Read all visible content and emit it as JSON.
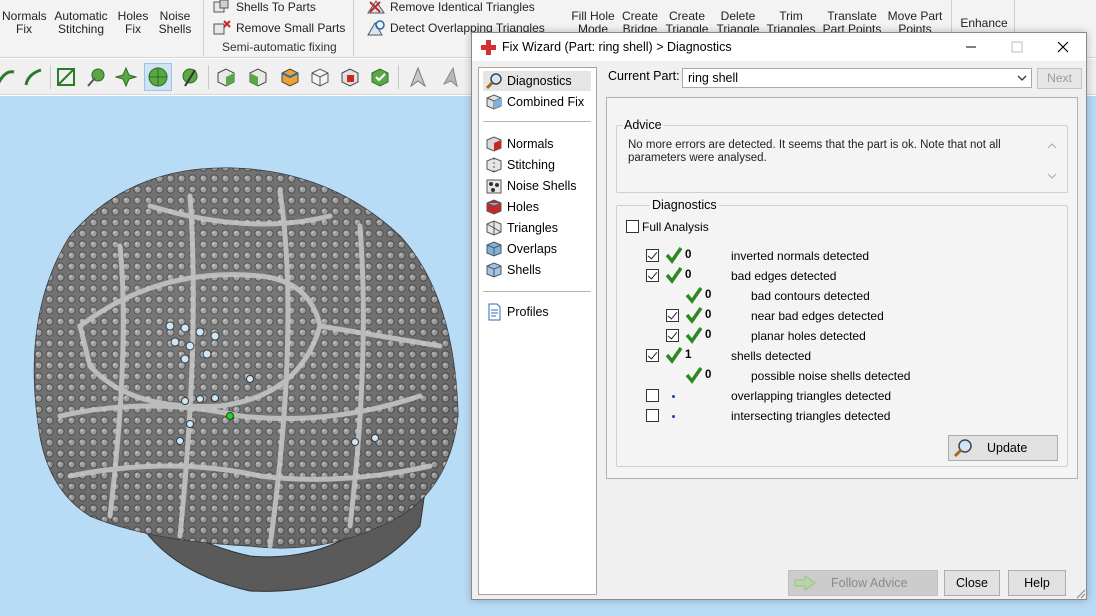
{
  "ribbon": {
    "buttons": [
      {
        "label": "Normals\nFix"
      },
      {
        "label": "Automatic\nStitching"
      },
      {
        "label": "Holes\nFix"
      },
      {
        "label": "Noise\nShells"
      },
      {
        "label": "Fill Hole\nMode"
      },
      {
        "label": "Create\nBridge"
      },
      {
        "label": "Create\nTriangle"
      },
      {
        "label": "Delete\nTriangle"
      },
      {
        "label": "Trim\nTriangles"
      },
      {
        "label": "Translate\nPart Points"
      },
      {
        "label": "Move Part\nPoints"
      },
      {
        "label": "Enhance"
      }
    ],
    "small": [
      "Shells To Parts",
      "Remove Small Parts",
      "Remove Identical Triangles",
      "Detect Overlapping Triangles"
    ],
    "group_label": "Semi-automatic fixing"
  },
  "toolbar": {
    "icons": [
      "bend-icon",
      "curve-icon",
      "mesh-select-icon",
      "shell-select-icon",
      "surface-select-icon",
      "sphere-select-icon",
      "sphere-cut-icon",
      "cube-green-icon",
      "cube-gray-icon",
      "cube-orange-icon",
      "cube-wire-icon",
      "cube-marked-icon",
      "cube-check-icon",
      "arrow-up-icon",
      "arrow-up-gray-icon"
    ]
  },
  "dialog": {
    "title": "Fix Wizard (Part: ring shell) > Diagnostics",
    "nav": [
      {
        "label": "Diagnostics",
        "icon": "magnifier-icon",
        "selected": true
      },
      {
        "label": "Combined Fix",
        "icon": "cube-combined-icon"
      },
      {
        "label": "Normals",
        "icon": "normals-icon"
      },
      {
        "label": "Stitching",
        "icon": "stitching-icon"
      },
      {
        "label": "Noise Shells",
        "icon": "noise-shells-icon"
      },
      {
        "label": "Holes",
        "icon": "holes-icon"
      },
      {
        "label": "Triangles",
        "icon": "triangles-icon"
      },
      {
        "label": "Overlaps",
        "icon": "overlaps-icon"
      },
      {
        "label": "Shells",
        "icon": "shells-icon"
      },
      {
        "label": "Profiles",
        "icon": "profiles-icon"
      }
    ],
    "current_part_label": "Current Part:",
    "current_part": "ring shell",
    "next_label": "Next",
    "advice_title": "Advice",
    "advice_text": "No more errors are detected. It seems that the part is ok. Note that not all parameters were analysed.",
    "diagnostics_title": "Diagnostics",
    "full_analysis": "Full Analysis",
    "rows": [
      {
        "checked": true,
        "status": "ok",
        "count": "0",
        "label": "inverted normals detected",
        "indent": 0
      },
      {
        "checked": true,
        "status": "ok",
        "count": "0",
        "label": "bad edges detected",
        "indent": 0
      },
      {
        "checked": null,
        "status": "ok",
        "count": "0",
        "label": "bad contours detected",
        "indent": 1
      },
      {
        "checked": true,
        "status": "ok",
        "count": "0",
        "label": "near bad edges detected",
        "indent": 1
      },
      {
        "checked": true,
        "status": "ok",
        "count": "0",
        "label": "planar holes detected",
        "indent": 1
      },
      {
        "checked": true,
        "status": "ok",
        "count": "1",
        "label": "shells detected",
        "indent": 0
      },
      {
        "checked": null,
        "status": "ok",
        "count": "0",
        "label": "possible noise shells detected",
        "indent": 1
      },
      {
        "checked": false,
        "status": "dot",
        "count": "",
        "label": "overlapping triangles detected",
        "indent": 0
      },
      {
        "checked": false,
        "status": "dot",
        "count": "",
        "label": "intersecting triangles detected",
        "indent": 0
      }
    ],
    "update_label": "Update",
    "follow_label": "Follow Advice",
    "close_label": "Close",
    "help_label": "Help"
  },
  "colors": {
    "viewport": "#b8dcf6",
    "check": "#2a8a1f",
    "accent": "#c62828"
  }
}
